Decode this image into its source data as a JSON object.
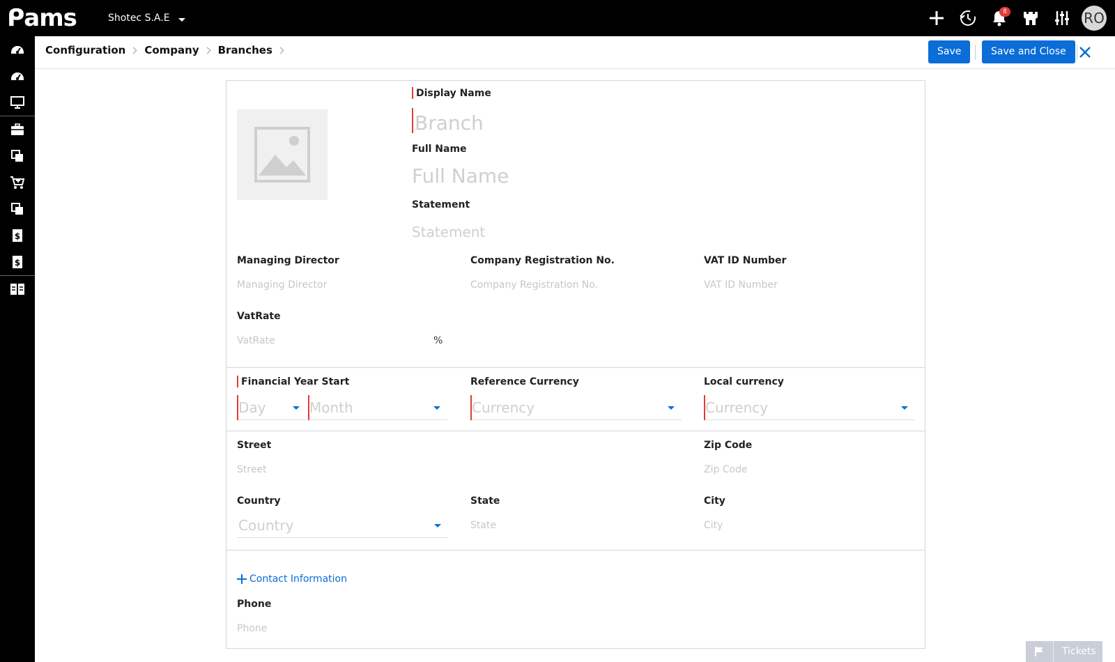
{
  "app": {
    "logo_text": "ams",
    "company": "Shotec S.A.E",
    "notification_count": "8",
    "user_initials": "RO"
  },
  "breadcrumb": [
    "Configuration",
    "Company",
    "Branches"
  ],
  "actions": {
    "save": "Save",
    "save_close": "Save and Close"
  },
  "form": {
    "display_name": {
      "label": "Display Name",
      "placeholder": "Branch"
    },
    "full_name": {
      "label": "Full Name",
      "placeholder": "Full Name"
    },
    "statement": {
      "label": "Statement",
      "placeholder": "Statement"
    },
    "managing_director": {
      "label": "Managing Director",
      "placeholder": "Managing Director"
    },
    "company_reg": {
      "label": "Company Registration No.",
      "placeholder": "Company Registration No."
    },
    "vat_id": {
      "label": "VAT ID Number",
      "placeholder": "VAT ID Number"
    },
    "vat_rate": {
      "label": "VatRate",
      "placeholder": "VatRate",
      "unit": "%"
    },
    "financial_year": {
      "label": "Financial Year Start",
      "day": "Day",
      "month": "Month"
    },
    "reference_currency": {
      "label": "Reference Currency",
      "placeholder": "Currency"
    },
    "local_currency": {
      "label": "Local currency",
      "placeholder": "Currency"
    },
    "street": {
      "label": "Street",
      "placeholder": "Street"
    },
    "zip": {
      "label": "Zip Code",
      "placeholder": "Zip Code"
    },
    "country": {
      "label": "Country",
      "placeholder": "Country"
    },
    "state": {
      "label": "State",
      "placeholder": "State"
    },
    "city": {
      "label": "City",
      "placeholder": "City"
    },
    "contact_link": "Contact Information",
    "phone": {
      "label": "Phone",
      "placeholder": "Phone"
    }
  },
  "tickets": {
    "label": "Tickets"
  },
  "colors": {
    "accent": "#0a6dd8",
    "required": "#e53935",
    "topbar": "#000000"
  }
}
